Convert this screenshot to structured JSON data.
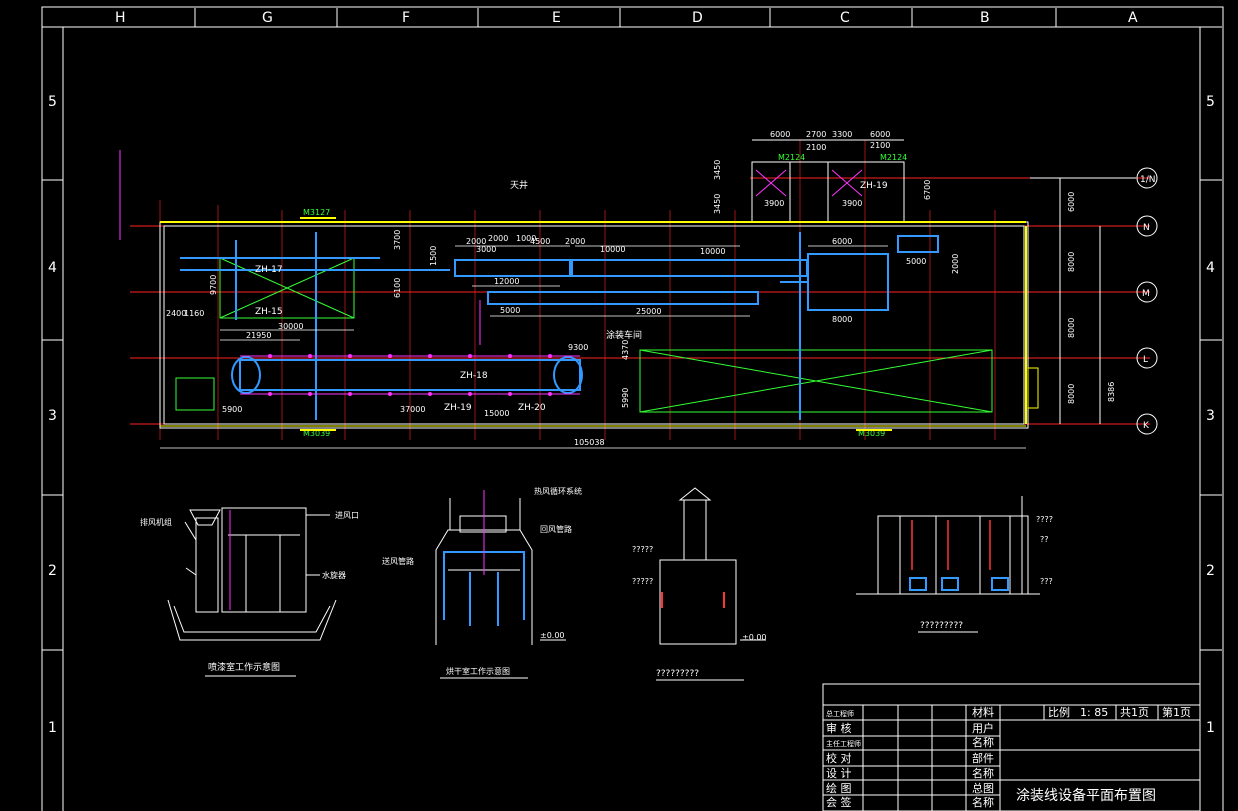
{
  "column_labels": [
    "H",
    "G",
    "F",
    "E",
    "D",
    "C",
    "B",
    "A"
  ],
  "row_labels": [
    "5",
    "4",
    "3",
    "2",
    "1"
  ],
  "axis_labels": [
    "1/N",
    "N",
    "M",
    "L",
    "K"
  ],
  "axis_dims": [
    "6000",
    "8000",
    "8000",
    "8000",
    "8386"
  ],
  "plan": {
    "skylight": "天井",
    "workshop": "涂装车间",
    "overall_length": "105038",
    "top_dims": [
      "6000",
      "2700",
      "3300",
      "6000"
    ],
    "top_subdims": [
      "2100",
      "2100"
    ],
    "doors": [
      "M2124",
      "M2124",
      "M3127",
      "M3039",
      "M3039"
    ],
    "zones": [
      "ZH-17",
      "ZH-15",
      "ZH-19",
      "ZH-18",
      "ZH-19",
      "ZH-20"
    ],
    "row_dims": [
      "2000",
      "3000",
      "2000",
      "1000",
      "4500",
      "2000",
      "10000",
      "10000",
      "6000",
      "5000",
      "12000",
      "5000",
      "25000",
      "8000",
      "30000",
      "21950",
      "37000",
      "5900",
      "9300",
      "15000"
    ],
    "side_dims": [
      "3450",
      "3450",
      "6700",
      "2000",
      "1500",
      "3700",
      "6100",
      "9700",
      "2400",
      "1160",
      "4370",
      "5990",
      "3900",
      "3900"
    ]
  },
  "details": [
    {
      "caption": "喷漆室工作示意图",
      "labels": [
        "排风机组",
        "进风口",
        "水旋器"
      ]
    },
    {
      "caption": "烘干室工作示意图",
      "labels": [
        "热风循环系统",
        "回风管路",
        "送风管路"
      ],
      "level": "±0.00"
    },
    {
      "caption": "?????????",
      "labels": [
        "?????",
        "?????"
      ],
      "level": "±0.00"
    },
    {
      "caption": "?????????",
      "labels": [
        "????",
        "??",
        "???"
      ]
    }
  ],
  "title_block": {
    "scale_label": "比例",
    "scale_value": "1: 85",
    "sheets_total": "共1页",
    "sheet_no": "第1页",
    "material": "材料",
    "user_name": [
      "用户",
      "名称"
    ],
    "part_name": [
      "部件",
      "名称"
    ],
    "general_name": [
      "总图",
      "名称"
    ],
    "roles": [
      "总工程师",
      "审    核",
      "主任工程师",
      "校    对",
      "设    计",
      "绘    图",
      "会    签"
    ],
    "drawing_title": "涂装线设备平面布置图"
  }
}
